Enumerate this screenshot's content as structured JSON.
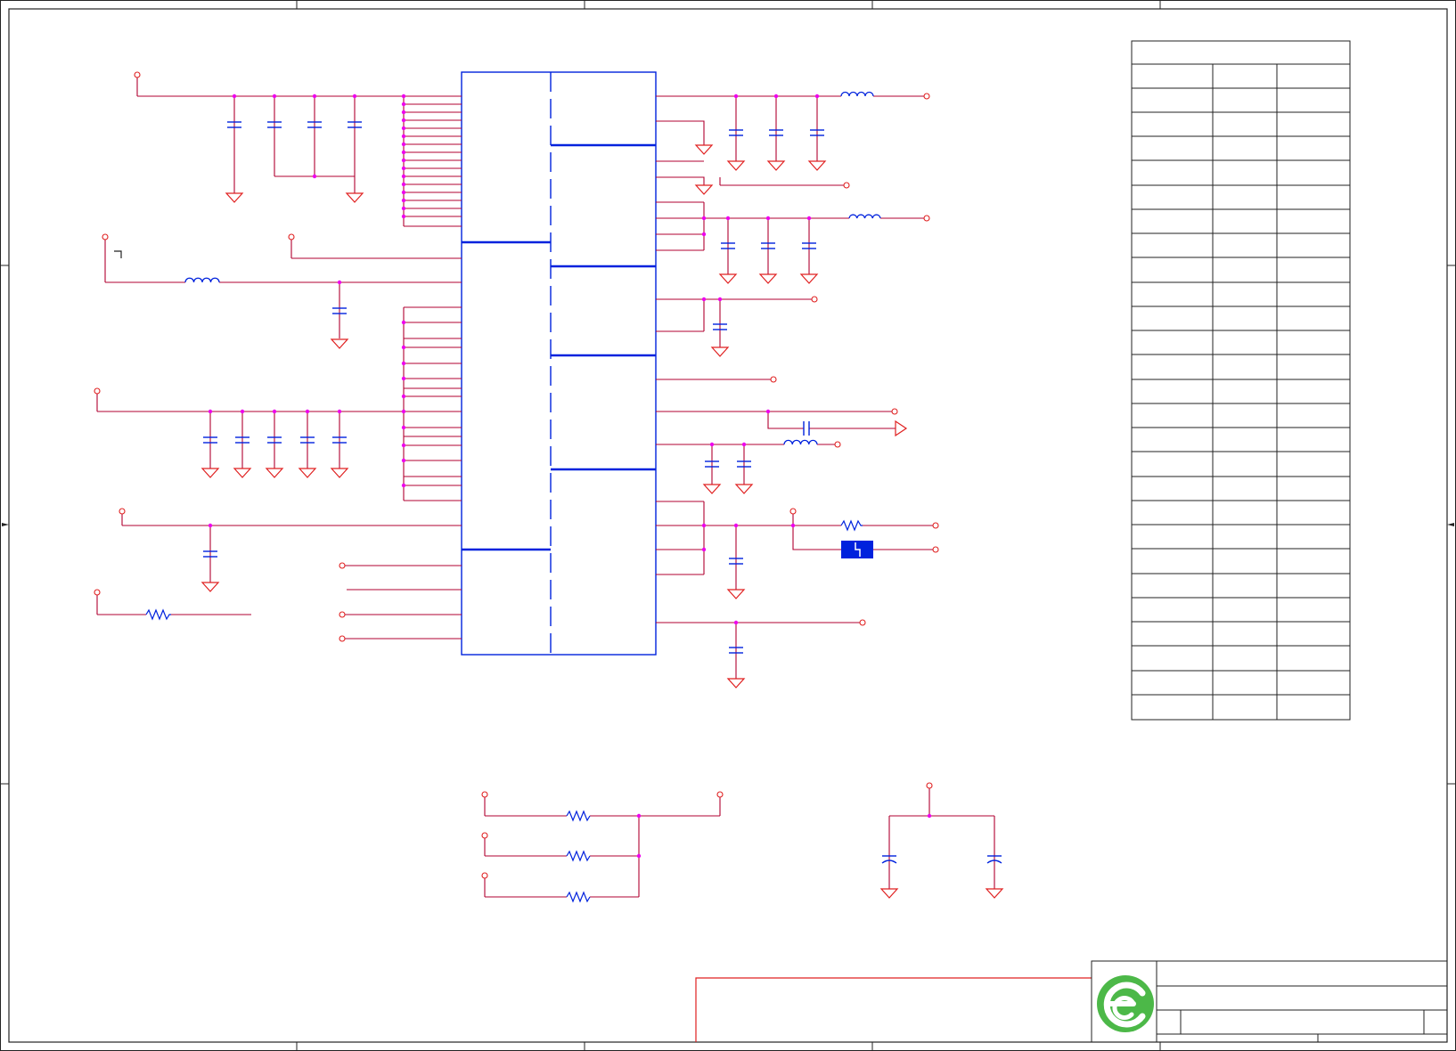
{
  "sheet": {
    "title": "",
    "description": "",
    "revision": ""
  },
  "colors": {
    "wire": "#b00030",
    "net_red": "#e02020",
    "component_blue": "#0022dd",
    "junction": "#ee00ee",
    "frame": "#222222",
    "logo_green": "#4cb848"
  },
  "icons": {
    "logo": "circular-green-e-logo-icon",
    "ground": "ground-triangle-icon",
    "capacitor": "capacitor-icon",
    "inductor": "inductor-icon",
    "resistor": "resistor-icon",
    "net_port": "net-port-circle-icon"
  }
}
